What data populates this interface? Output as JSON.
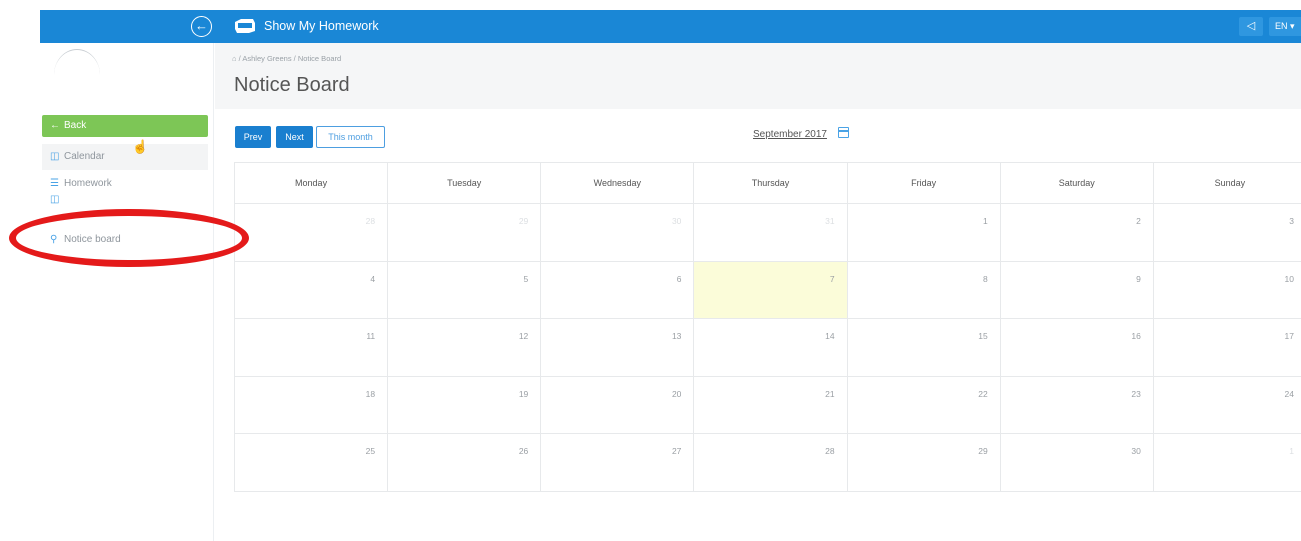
{
  "app": {
    "title": "Show My Homework",
    "language": "EN ▾"
  },
  "icons": {
    "back": "arrow-left-icon",
    "megaphone": "megaphone-icon",
    "home": "home-icon",
    "calendar": "calendar-icon",
    "list": "list-icon",
    "pin": "pin-icon",
    "cursor": "hand-cursor-icon"
  },
  "colors": {
    "topbar": "#1a87d6",
    "back": "#7dc656",
    "primary": "#1a7fcf",
    "today": "#fbfcd9",
    "annotation": "#e41a1a"
  },
  "sidebar": {
    "items": [
      {
        "label": "Back",
        "icon": "←"
      },
      {
        "label": "Calendar",
        "icon": "◫"
      },
      {
        "label": "Homework",
        "icon": "☰"
      },
      {
        "label": "Notice board",
        "icon": "⚲"
      }
    ]
  },
  "header": {
    "breadcrumb": [
      "Ashley Greens",
      "Notice Board"
    ],
    "title": "Notice Board"
  },
  "controls": {
    "prev": "Prev",
    "next": "Next",
    "this_month": "This month",
    "month": "September 2017"
  },
  "calendar": {
    "days": [
      "Monday",
      "Tuesday",
      "Wednesday",
      "Thursday",
      "Friday",
      "Saturday",
      "Sunday"
    ],
    "weeks": [
      [
        {
          "d": "28",
          "o": true
        },
        {
          "d": "29",
          "o": true
        },
        {
          "d": "30",
          "o": true
        },
        {
          "d": "31",
          "o": true
        },
        {
          "d": "1"
        },
        {
          "d": "2"
        },
        {
          "d": "3"
        }
      ],
      [
        {
          "d": "4"
        },
        {
          "d": "5"
        },
        {
          "d": "6"
        },
        {
          "d": "7",
          "today": true
        },
        {
          "d": "8"
        },
        {
          "d": "9"
        },
        {
          "d": "10"
        }
      ],
      [
        {
          "d": "11"
        },
        {
          "d": "12"
        },
        {
          "d": "13"
        },
        {
          "d": "14"
        },
        {
          "d": "15"
        },
        {
          "d": "16"
        },
        {
          "d": "17"
        }
      ],
      [
        {
          "d": "18"
        },
        {
          "d": "19"
        },
        {
          "d": "20"
        },
        {
          "d": "21"
        },
        {
          "d": "22"
        },
        {
          "d": "23"
        },
        {
          "d": "24"
        }
      ],
      [
        {
          "d": "25"
        },
        {
          "d": "26"
        },
        {
          "d": "27"
        },
        {
          "d": "28"
        },
        {
          "d": "29"
        },
        {
          "d": "30"
        },
        {
          "d": "1",
          "o": true
        }
      ]
    ]
  }
}
